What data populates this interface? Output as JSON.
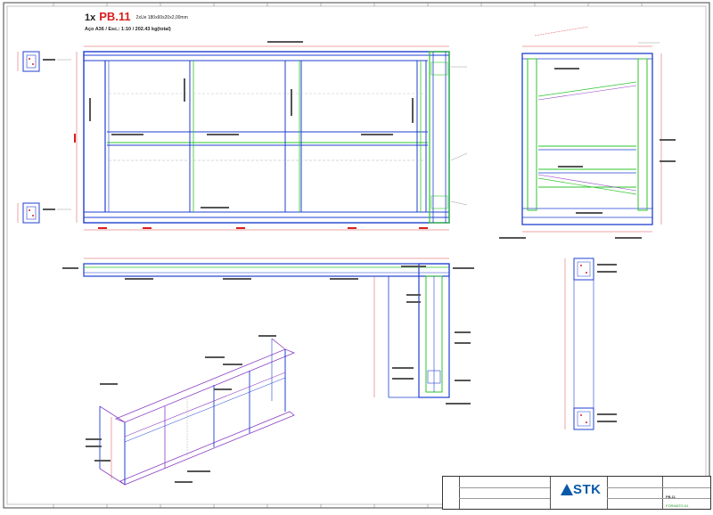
{
  "header": {
    "qty": "1x",
    "ref": "PB.11",
    "profile": "2xUe 180x60x20x2,00mm",
    "subtitle": "Aço A36 / Esc.: 1:10 / 202.43 kg(total)"
  },
  "title_block": {
    "company": "STK",
    "sheet": "PB.11",
    "format": "FORMATO A1"
  },
  "colors": {
    "frame": "#4a4a4a",
    "steel_blue": "#1e3fd0",
    "steel_green": "#2ec42e",
    "dimension_red": "#d62020",
    "brace_purple": "#8c3fc4",
    "dashed_gray": "#b0b0b0"
  }
}
